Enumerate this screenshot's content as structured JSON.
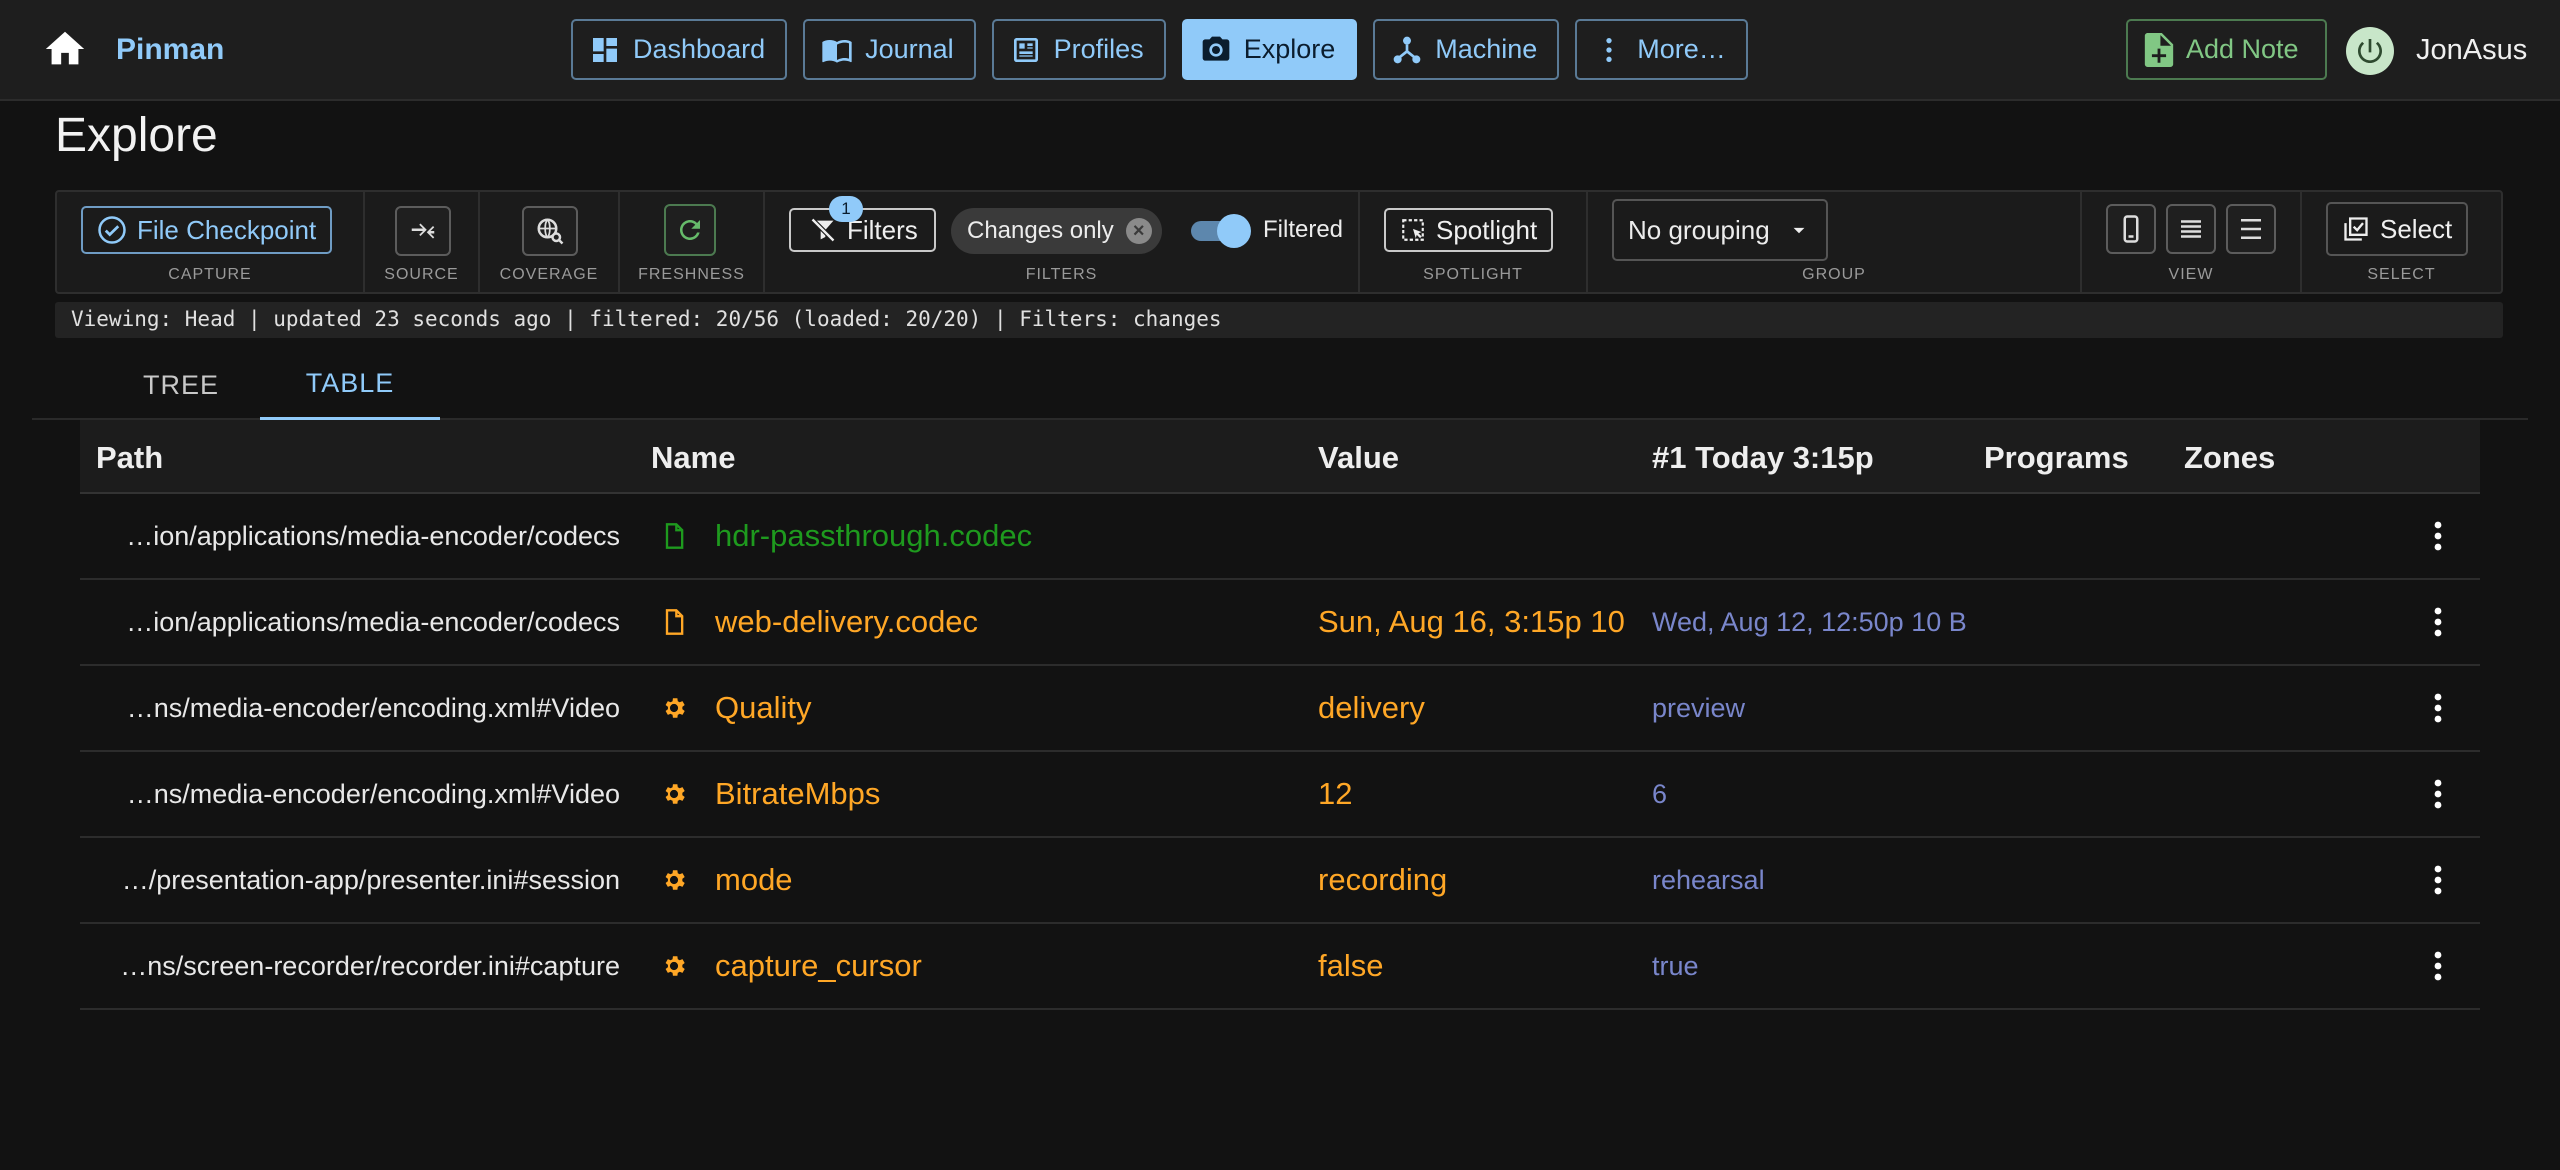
{
  "app": {
    "brand": "Pinman",
    "user": "JonAsus"
  },
  "nav": [
    {
      "label": "Dashboard",
      "icon": "dashboard-icon",
      "active": false
    },
    {
      "label": "Journal",
      "icon": "book-icon",
      "active": false
    },
    {
      "label": "Profiles",
      "icon": "profile-card-icon",
      "active": false
    },
    {
      "label": "Explore",
      "icon": "camera-icon",
      "active": true
    },
    {
      "label": "Machine",
      "icon": "hub-icon",
      "active": false
    },
    {
      "label": "More…",
      "icon": "more-vertical-icon",
      "active": false
    }
  ],
  "add_note": {
    "label": "Add Note",
    "icon": "note-add-icon"
  },
  "page": {
    "title": "Explore"
  },
  "toolbar": {
    "capture": {
      "button": "File Checkpoint",
      "label": "CAPTURE"
    },
    "source": {
      "label": "SOURCE"
    },
    "coverage": {
      "label": "COVERAGE"
    },
    "freshness": {
      "label": "FRESHNESS"
    },
    "filters": {
      "button": "Filters",
      "badge": "1",
      "chip": "Changes only",
      "toggle_label": "Filtered",
      "toggle_on": true,
      "label": "FILTERS"
    },
    "spotlight": {
      "button": "Spotlight",
      "label": "SPOTLIGHT"
    },
    "group": {
      "value": "No grouping",
      "label": "GROUP"
    },
    "view": {
      "label": "VIEW"
    },
    "select": {
      "button": "Select",
      "label": "SELECT"
    }
  },
  "status": "Viewing: Head | updated 23 seconds ago | filtered: 20/56 (loaded: 20/20) | Filters: changes",
  "tabs": [
    {
      "label": "TREE",
      "active": false
    },
    {
      "label": "TABLE",
      "active": true
    }
  ],
  "table": {
    "columns": [
      "Path",
      "Name",
      "Value",
      "#1 Today 3:15p",
      "Programs",
      "Zones"
    ],
    "rows": [
      {
        "path": "…ion/applications/media-encoder/codecs",
        "icon": "file-icon",
        "name": "hdr-passthrough.codec",
        "name_color": "#1e9a1e",
        "value": "",
        "baseline": ""
      },
      {
        "path": "…ion/applications/media-encoder/codecs",
        "icon": "file-icon",
        "name": "web-delivery.codec",
        "name_color": "#ffa726",
        "value": "Sun, Aug 16, 3:15p 10",
        "baseline": "Wed, Aug 12, 12:50p 10 B"
      },
      {
        "path": "…ns/media-encoder/encoding.xml#Video",
        "icon": "gear-icon",
        "name": "Quality",
        "name_color": "#ffa726",
        "value": "delivery",
        "baseline": "preview"
      },
      {
        "path": "…ns/media-encoder/encoding.xml#Video",
        "icon": "gear-icon",
        "name": "BitrateMbps",
        "name_color": "#ffa726",
        "value": "12",
        "baseline": "6"
      },
      {
        "path": "…/presentation-app/presenter.ini#session",
        "icon": "gear-icon",
        "name": "mode",
        "name_color": "#ffa726",
        "value": "recording",
        "baseline": "rehearsal"
      },
      {
        "path": "…ns/screen-recorder/recorder.ini#capture",
        "icon": "gear-icon",
        "name": "capture_cursor",
        "name_color": "#ffa726",
        "value": "false",
        "baseline": "true"
      }
    ]
  },
  "colors": {
    "accent": "#90caf9",
    "added": "#1e9a1e",
    "changed": "#ffa726",
    "baseline": "#7986cb",
    "add_note": "#81c784"
  }
}
